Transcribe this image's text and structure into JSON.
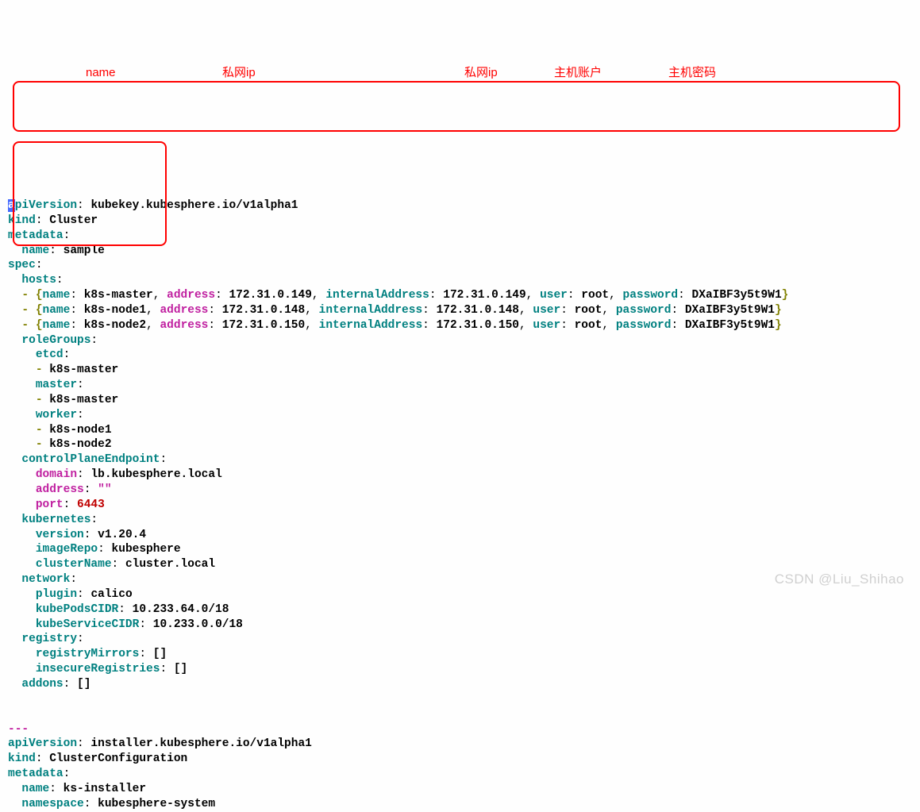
{
  "annot": {
    "name": "name",
    "privIp1": "私网ip",
    "privIp2": "私网ip",
    "hostUser": "主机账户",
    "hostPwd": "主机密码"
  },
  "doc1": {
    "apiVersion": "kubekey.kubesphere.io/v1alpha1",
    "kind": "Cluster",
    "metadata_name": "sample",
    "hosts": [
      {
        "name": "k8s-master",
        "address": "172.31.0.149",
        "internalAddress": "172.31.0.149",
        "user": "root",
        "password": "DXaIBF3y5t9W1"
      },
      {
        "name": "k8s-node1",
        "address": "172.31.0.148",
        "internalAddress": "172.31.0.148",
        "user": "root",
        "password": "DXaIBF3y5t9W1"
      },
      {
        "name": "k8s-node2",
        "address": "172.31.0.150",
        "internalAddress": "172.31.0.150",
        "user": "root",
        "password": "DXaIBF3y5t9W1"
      }
    ],
    "roleGroups": {
      "etcd": [
        "k8s-master"
      ],
      "master": [
        "k8s-master"
      ],
      "worker": [
        "k8s-node1",
        "k8s-node2"
      ]
    },
    "controlPlaneEndpoint": {
      "domain": "lb.kubesphere.local",
      "address": "\"\"",
      "port": "6443"
    },
    "kubernetes": {
      "version": "v1.20.4",
      "imageRepo": "kubesphere",
      "clusterName": "cluster.local"
    },
    "network": {
      "plugin": "calico",
      "kubePodsCIDR": "10.233.64.0/18",
      "kubeServiceCIDR": "10.233.0.0/18"
    },
    "registry": {
      "registryMirrors": "[]",
      "insecureRegistries": "[]"
    },
    "addons": "[]"
  },
  "doc2": {
    "apiVersion": "installer.kubesphere.io/v1alpha1",
    "kind": "ClusterConfiguration",
    "metadata_name": "ks-installer",
    "metadata_namespace": "kubesphere-system"
  },
  "watermark": "CSDN @Liu_Shihao"
}
